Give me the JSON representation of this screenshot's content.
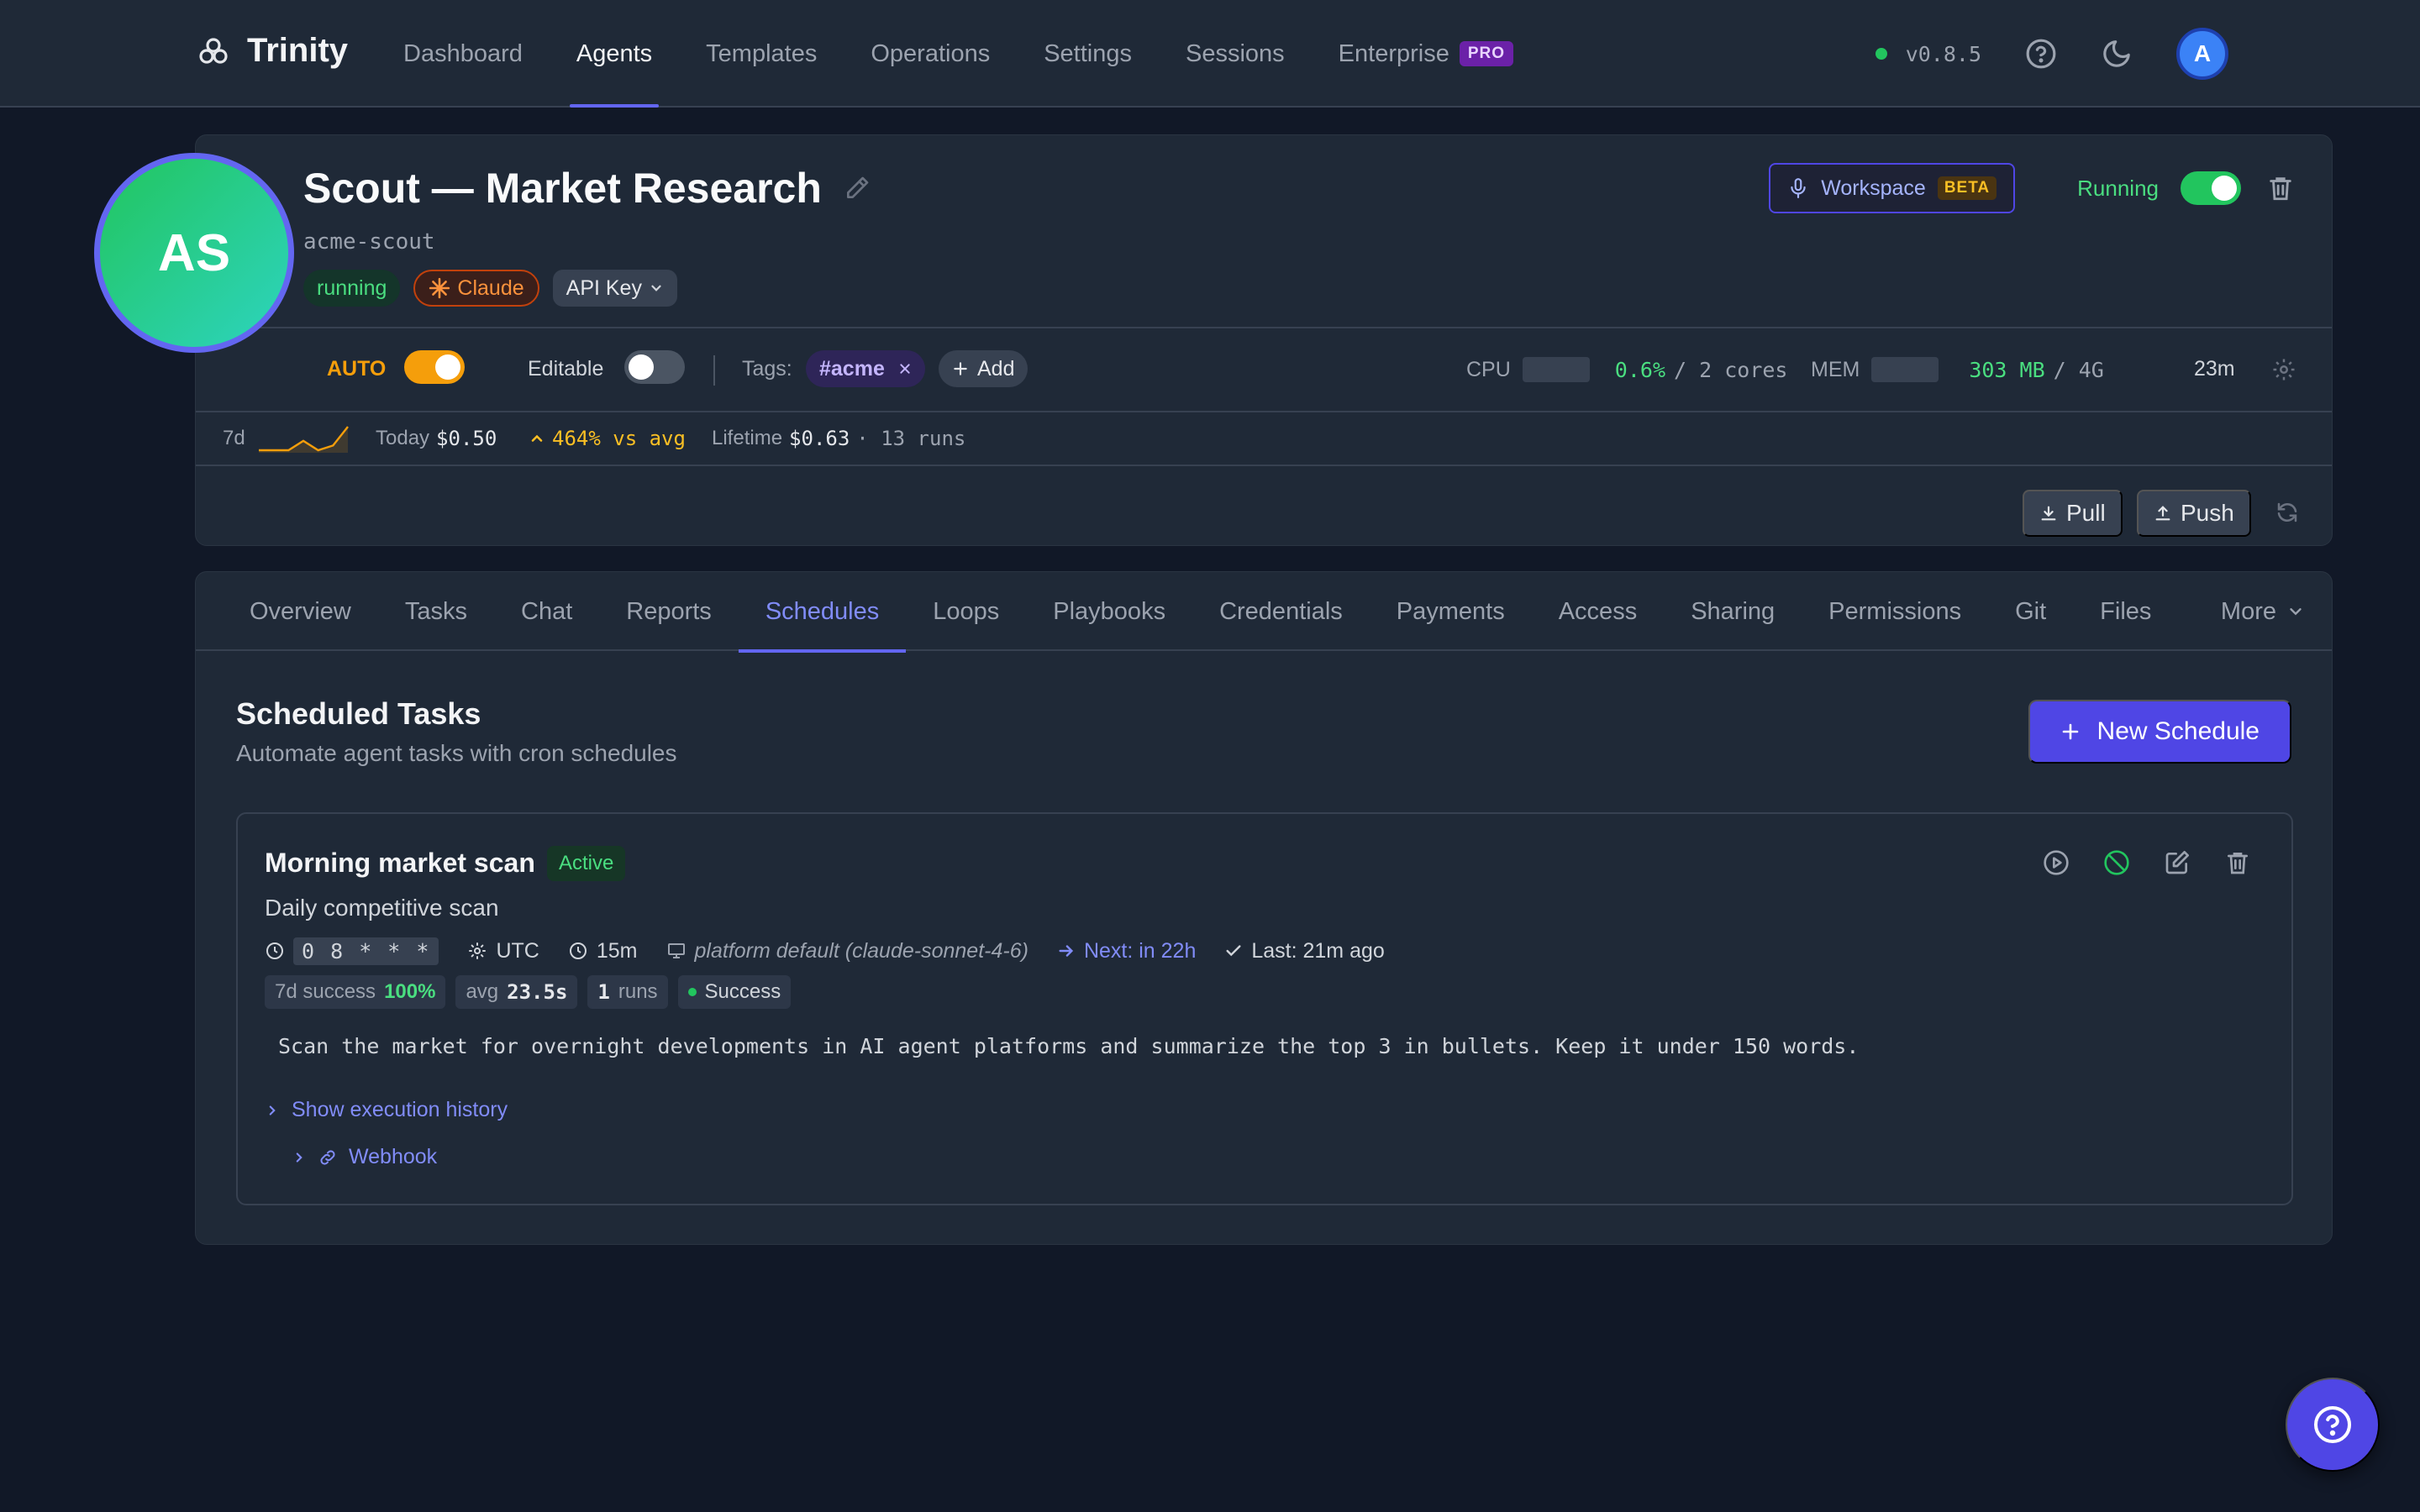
{
  "app": {
    "brand": "Trinity",
    "nav": [
      "Dashboard",
      "Agents",
      "Templates",
      "Operations",
      "Settings",
      "Sessions",
      "Enterprise"
    ],
    "nav_active": "Agents",
    "pro_badge": "PRO",
    "version": "v0.8.5",
    "user_initial": "A",
    "colors": {
      "accent": "#6366f1",
      "success": "#22c55e",
      "warning": "#f59e0b",
      "bg": "#111827",
      "panel": "#1f2937"
    }
  },
  "agent": {
    "initials": "AS",
    "name": "Scout — Market Research",
    "slug": "acme-scout",
    "status_chip": "running",
    "model_chip": "Claude",
    "auth_chip": "API Key",
    "workspace_label": "Workspace",
    "beta_badge": "BETA",
    "running_label": "Running",
    "running_on": true,
    "auto_label": "AUTO",
    "auto_on": true,
    "editable_label": "Editable",
    "editable_on": false,
    "tags_label": "Tags:",
    "tags": [
      "#acme"
    ],
    "add_tag_label": "Add",
    "cpu": {
      "label": "CPU",
      "value": "0.6%",
      "limit": "/ 2 cores"
    },
    "mem": {
      "label": "MEM",
      "value": "303 MB",
      "limit": "/ 4G"
    },
    "uptime": "23m",
    "cost": {
      "period": "7d",
      "sparkline": [
        1.0,
        1.0,
        1.0,
        0.6,
        1.0,
        0.8,
        0.0
      ],
      "today_label": "Today",
      "today_value": "$0.50",
      "trend": "464% vs avg",
      "lifetime_label": "Lifetime",
      "lifetime_value": "$0.63",
      "runs": "· 13 runs"
    },
    "pull_label": "Pull",
    "push_label": "Push"
  },
  "tabs": [
    "Overview",
    "Tasks",
    "Chat",
    "Reports",
    "Schedules",
    "Loops",
    "Playbooks",
    "Credentials",
    "Payments",
    "Access",
    "Sharing",
    "Permissions",
    "Git",
    "Files"
  ],
  "tab_active": "Schedules",
  "tab_more": "More",
  "schedules": {
    "title": "Scheduled Tasks",
    "subtitle": "Automate agent tasks with cron schedules",
    "new_button": "New Schedule",
    "items": [
      {
        "name": "Morning market scan",
        "status": "Active",
        "description": "Daily competitive scan",
        "cron": "0 8 * * *",
        "timezone": "UTC",
        "timeout": "15m",
        "model": "platform default (claude-sonnet-4-6)",
        "next": "Next: in 22h",
        "last": "Last: 21m ago",
        "success_label": "7d success",
        "success_value": "100%",
        "avg_label": "avg",
        "avg_value": "23.5s",
        "runs_value": "1",
        "runs_label": "runs",
        "last_result": "Success",
        "prompt": "Scan the market for overnight developments in AI agent platforms and summarize the top 3 in bullets. Keep it under 150 words.",
        "history_link": "Show execution history",
        "webhook_link": "Webhook"
      }
    ]
  }
}
